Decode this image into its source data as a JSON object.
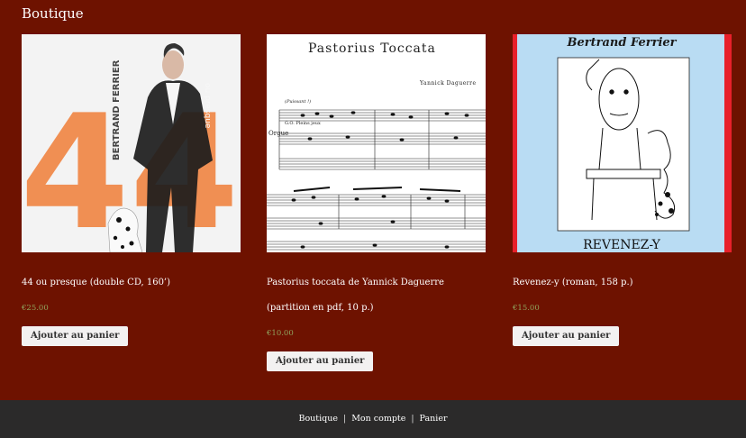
{
  "page": {
    "title": "Boutique"
  },
  "colors": {
    "background": "#6e1200",
    "footer": "#2b2a2a",
    "price": "#8fa35c",
    "button_bg": "#f3f1f1"
  },
  "products": [
    {
      "title": "44 ou presque (double CD, 160’)",
      "price": "€25.00",
      "button": "Ajouter au panier",
      "cover": {
        "artist": "BERTRAND FERRIER",
        "number": "44",
        "subtitle": "ou presque"
      }
    },
    {
      "title": "Pastorius toccata de Yannick Daguerre (partition en pdf, 10 p.)",
      "price": "€10.00",
      "button": "Ajouter au panier",
      "cover": {
        "heading": "Pastorius Toccata",
        "composer": "Yannick Daguerre",
        "instrument": "Orgue",
        "tempo": "(Puissant !)",
        "registration": "G.O. Pleins jeux"
      }
    },
    {
      "title": "Revenez-y (roman, 158 p.)",
      "price": "€15.00",
      "button": "Ajouter au panier",
      "cover": {
        "author": "Bertrand Ferrier",
        "title": "REVENEZ-Y"
      }
    }
  ],
  "footer": {
    "links": [
      "Boutique",
      "Mon compte",
      "Panier"
    ],
    "separator": "|"
  }
}
